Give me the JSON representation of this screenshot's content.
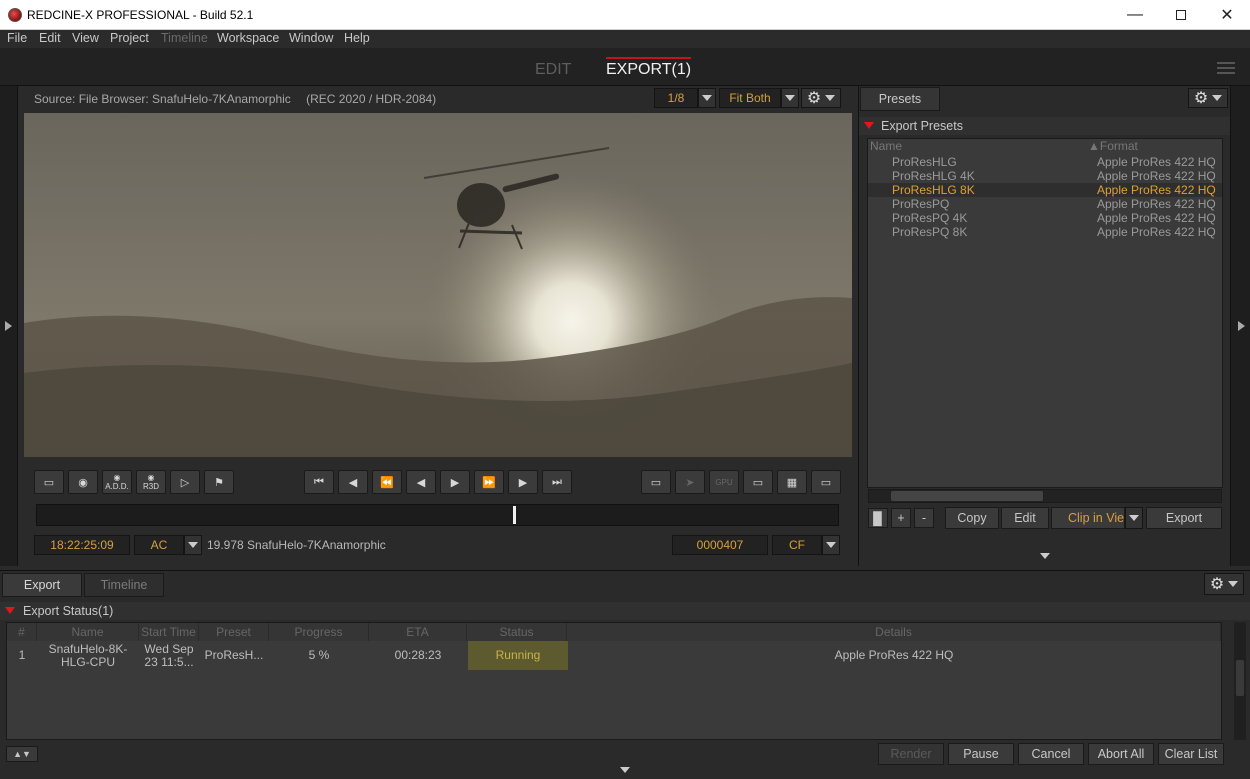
{
  "window": {
    "title": "REDCINE-X PROFESSIONAL - Build 52.1"
  },
  "menu": [
    "File",
    "Edit",
    "View",
    "Project",
    "Timeline",
    "Workspace",
    "Window",
    "Help"
  ],
  "modes": {
    "edit": "EDIT",
    "export": "EXPORT(1)"
  },
  "viewer": {
    "source": "Source: File Browser: SnafuHelo-7KAnamorphic",
    "color_space": "(REC 2020 / HDR-2084)",
    "resolution": "1/8",
    "fit": "Fit Both",
    "timecode": "18:22:25:09",
    "timecode_mode": "AC",
    "clip_info": "19.978 SnafuHelo-7KAnamorphic",
    "frame": "0000407",
    "frame_mode": "CF",
    "add_label": "A.D.D.",
    "r3d_label": "R3D",
    "gpu_label": "GPU",
    "playhead_fraction": 0.597
  },
  "presets": {
    "tab": "Presets",
    "section": "Export Presets",
    "col_name": "Name",
    "col_format": "Format",
    "rows": [
      {
        "name": "ProResHLG",
        "format": "Apple ProRes 422 HQ"
      },
      {
        "name": "ProResHLG 4K",
        "format": "Apple ProRes 422 HQ"
      },
      {
        "name": "ProResHLG 8K",
        "format": "Apple ProRes 422 HQ"
      },
      {
        "name": "ProResPQ",
        "format": "Apple ProRes 422 HQ"
      },
      {
        "name": "ProResPQ 4K",
        "format": "Apple ProRes 422 HQ"
      },
      {
        "name": "ProResPQ 8K",
        "format": "Apple ProRes 422 HQ"
      }
    ],
    "copy": "Copy",
    "edit": "Edit",
    "clip_in_view": "Clip in Viev",
    "export": "Export",
    "plus": "+",
    "minus": "-"
  },
  "bottom": {
    "tab_export": "Export",
    "tab_timeline": "Timeline",
    "section": "Export Status(1)",
    "headers": [
      "#",
      "Name",
      "Start Time",
      "Preset",
      "Progress",
      "ETA",
      "Status",
      "Details"
    ],
    "job": {
      "num": "1",
      "name_1": "SnafuHelo-8K-",
      "name_2": "HLG-CPU",
      "start_1": "Wed Sep",
      "start_2": "23 11:5...",
      "preset": "ProResH...",
      "progress": "5 %",
      "eta": "00:28:23",
      "status": "Running",
      "details": "Apple ProRes 422 HQ"
    },
    "render": "Render",
    "pause": "Pause",
    "cancel": "Cancel",
    "abort_all": "Abort All",
    "clear_list": "Clear List"
  }
}
